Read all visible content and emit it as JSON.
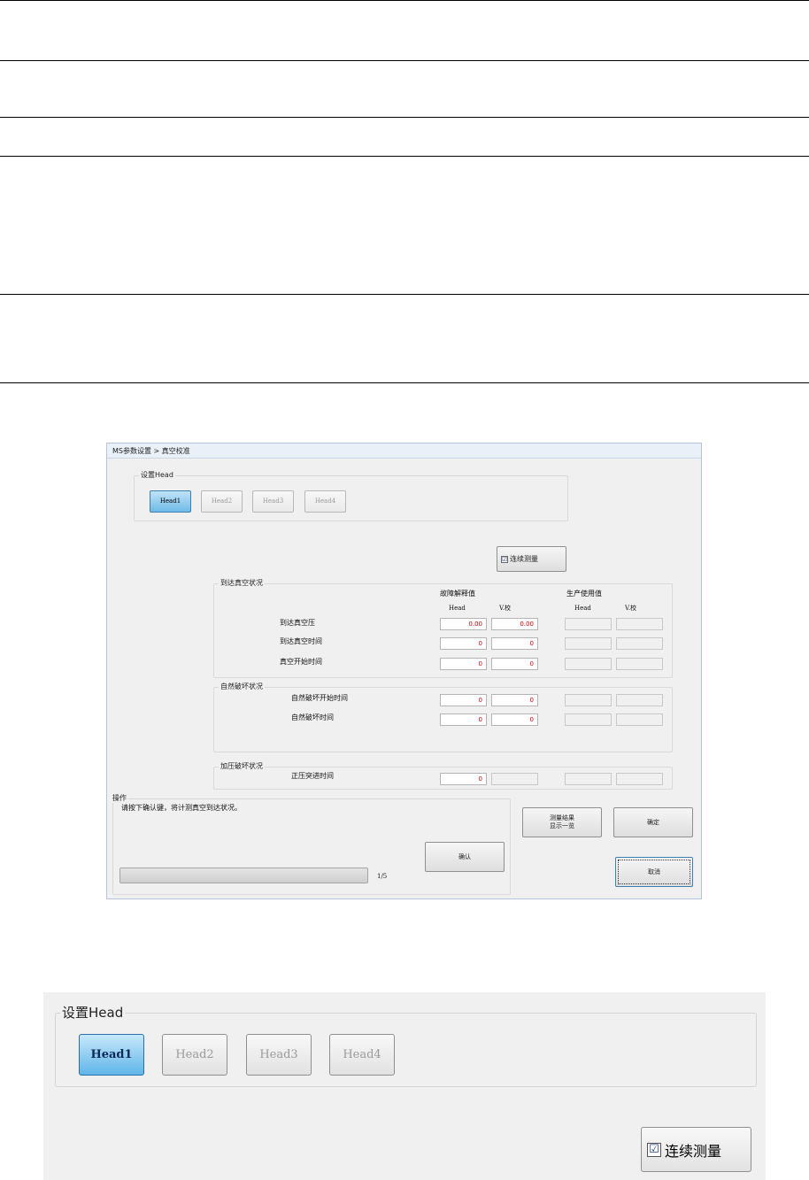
{
  "dialog": {
    "title": "MS参数设置 > 真空校准",
    "set_head_group": "设置Head",
    "head_buttons": [
      "Head1",
      "Head2",
      "Head3",
      "Head4"
    ],
    "continuous_checkbox": {
      "label": "连续测量",
      "checked": true,
      "check_glyph": "☑"
    },
    "section_vacuum": "到达真空状况",
    "section_natural": "自然破坏状况",
    "section_pressure": "加压破坏状况",
    "col_troubleshoot": "故障解释值",
    "col_production": "生产使用值",
    "col_head": "Head",
    "col_vcal": "V.校",
    "rows": [
      {
        "label": "到达真空压",
        "head": "0.00",
        "vcal": "0.00"
      },
      {
        "label": "到达真空时间",
        "head": "0",
        "vcal": "0"
      },
      {
        "label": "真空开始时间",
        "head": "0",
        "vcal": "0"
      },
      {
        "label": "自然破坏开始时间",
        "head": "0",
        "vcal": "0"
      },
      {
        "label": "自然破坏时间",
        "head": "0",
        "vcal": "0"
      },
      {
        "label": "正压突进时间",
        "head": "0",
        "vcal": ""
      }
    ],
    "operation_label": "操作",
    "operation_message": "请按下确认键，将计测真空到达状况。",
    "confirm_button": "确认",
    "progress_text": "1/5",
    "progress_fraction": 0,
    "results_button_line1": "测量结果",
    "results_button_line2": "显示一览",
    "ok_button": "确定",
    "cancel_button": "取消"
  },
  "zoom": {
    "set_head_group": "设置Head",
    "head_buttons": [
      "Head1",
      "Head2",
      "Head3",
      "Head4"
    ],
    "continuous_checkbox": {
      "label": "连续测量",
      "check_glyph": "☑"
    }
  },
  "colors": {
    "accent_blue": "#5fb5e8",
    "value_red": "#cc0000"
  }
}
